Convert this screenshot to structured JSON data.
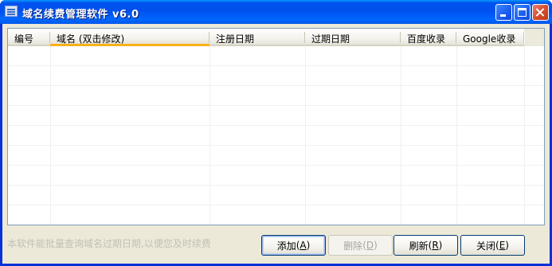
{
  "window": {
    "title": "域名续费管理软件 v6.0",
    "controls": {
      "minimize": "minimize-icon",
      "maximize": "maximize-icon",
      "close": "close-icon"
    }
  },
  "table": {
    "columns": [
      "编号",
      "域名 (双击修改)",
      "注册日期",
      "过期日期",
      "百度收录",
      "Google收录"
    ],
    "sorted_column": "域名 (双击修改)",
    "rows": []
  },
  "footer": {
    "hint": "本软件能批量查询域名过期日期,以便您及时续费",
    "buttons": {
      "add": {
        "label": "添加",
        "mnemonic": "A"
      },
      "delete": {
        "label": "删除",
        "mnemonic": "D"
      },
      "refresh": {
        "label": "刷新",
        "mnemonic": "R"
      },
      "close": {
        "label": "关闭",
        "mnemonic": "E"
      }
    }
  },
  "colors": {
    "titlebar": "#0053ee",
    "frame": "#0831d9",
    "sort_indicator": "#f9b119",
    "hint_text": "#c2c0b6"
  }
}
